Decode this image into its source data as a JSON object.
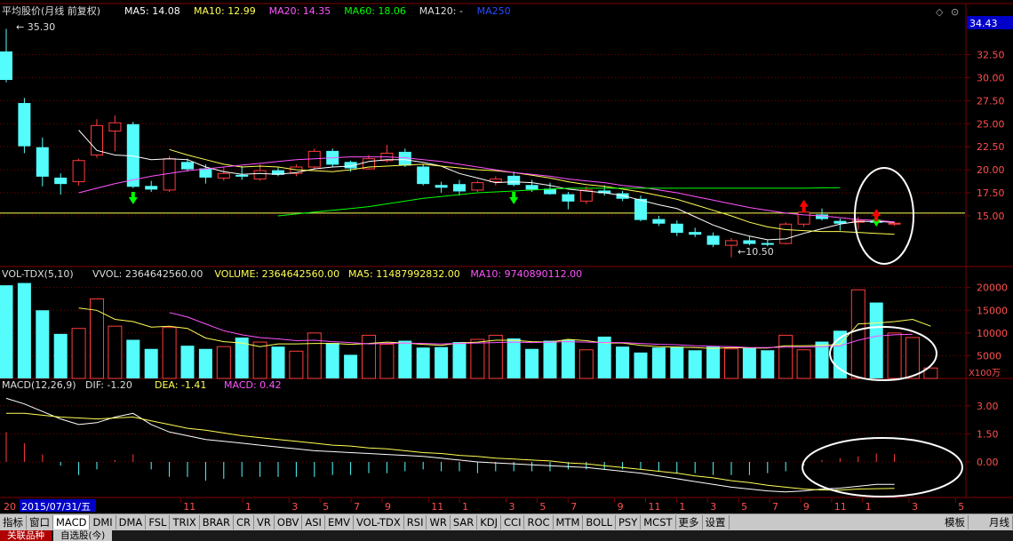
{
  "colors": {
    "up": "#ff3c3c",
    "down": "#54fcfc",
    "ma5": "#ffffff",
    "ma10": "#ffff54",
    "ma20": "#ff54ff",
    "ma60": "#00ff00",
    "ma250": "#2a4bff",
    "grid": "#800000",
    "hline": "#ffff54",
    "circle": "#ffffff"
  },
  "chart_data": [
    {
      "type": "candlestick",
      "title": "平均股价(月线 前复权)",
      "ma_legend": [
        {
          "name": "MA5",
          "text": "MA5: 14.08",
          "color": "#ffffff"
        },
        {
          "name": "MA10",
          "text": "MA10: 12.99",
          "color": "#ffff54"
        },
        {
          "name": "MA20",
          "text": "MA20: 14.35",
          "color": "#ff54ff"
        },
        {
          "name": "MA60",
          "text": "MA60: 18.06",
          "color": "#00ff00"
        },
        {
          "name": "MA120",
          "text": "MA120: -",
          "color": "#dddddd"
        },
        {
          "name": "MA250",
          "text": "MA250",
          "color": "#2a4bff"
        }
      ],
      "ylim": [
        9.5,
        36.5
      ],
      "y_ticks": [
        15.0,
        17.5,
        20.0,
        22.5,
        25.0,
        27.5,
        30.0,
        32.5
      ],
      "y_tick_labels": [
        "15.00",
        "17.50",
        "20.00",
        "22.50",
        "25.00",
        "27.50",
        "30.00",
        "32.50"
      ],
      "current_price_label": "34.43",
      "high_annotation": "35.30",
      "low_annotation": "10.50",
      "horizontal_line": 15.3,
      "candles": [
        {
          "o": 32.8,
          "h": 35.3,
          "l": 29.5,
          "c": 29.8
        },
        {
          "o": 27.2,
          "h": 27.8,
          "l": 21.8,
          "c": 22.6
        },
        {
          "o": 22.4,
          "h": 23.5,
          "l": 18.2,
          "c": 19.3
        },
        {
          "o": 19.1,
          "h": 19.6,
          "l": 17.3,
          "c": 18.5
        },
        {
          "o": 18.7,
          "h": 21.2,
          "l": 18.3,
          "c": 21.0
        },
        {
          "o": 21.6,
          "h": 25.5,
          "l": 21.3,
          "c": 24.8
        },
        {
          "o": 24.2,
          "h": 25.9,
          "l": 22.0,
          "c": 25.1
        },
        {
          "o": 24.9,
          "h": 25.2,
          "l": 18.0,
          "c": 18.2
        },
        {
          "o": 18.2,
          "h": 18.8,
          "l": 17.6,
          "c": 17.9
        },
        {
          "o": 17.8,
          "h": 21.5,
          "l": 17.6,
          "c": 21.2
        },
        {
          "o": 20.8,
          "h": 21.2,
          "l": 19.8,
          "c": 20.1
        },
        {
          "o": 20.1,
          "h": 20.6,
          "l": 18.5,
          "c": 19.2
        },
        {
          "o": 19.1,
          "h": 20.3,
          "l": 18.8,
          "c": 19.6
        },
        {
          "o": 19.4,
          "h": 20.4,
          "l": 18.9,
          "c": 19.3
        },
        {
          "o": 19.0,
          "h": 20.6,
          "l": 18.8,
          "c": 19.9
        },
        {
          "o": 19.9,
          "h": 20.3,
          "l": 19.3,
          "c": 19.5
        },
        {
          "o": 19.6,
          "h": 20.6,
          "l": 19.3,
          "c": 20.3
        },
        {
          "o": 20.3,
          "h": 22.3,
          "l": 20.0,
          "c": 22.0
        },
        {
          "o": 22.0,
          "h": 22.3,
          "l": 20.3,
          "c": 20.6
        },
        {
          "o": 20.8,
          "h": 21.0,
          "l": 19.8,
          "c": 20.2
        },
        {
          "o": 20.1,
          "h": 21.6,
          "l": 20.0,
          "c": 21.2
        },
        {
          "o": 21.0,
          "h": 22.7,
          "l": 20.8,
          "c": 21.8
        },
        {
          "o": 21.9,
          "h": 22.3,
          "l": 20.3,
          "c": 20.5
        },
        {
          "o": 20.3,
          "h": 20.6,
          "l": 18.3,
          "c": 18.5
        },
        {
          "o": 18.3,
          "h": 18.7,
          "l": 17.5,
          "c": 18.1
        },
        {
          "o": 18.4,
          "h": 18.9,
          "l": 17.2,
          "c": 17.7
        },
        {
          "o": 17.8,
          "h": 18.8,
          "l": 17.6,
          "c": 18.6
        },
        {
          "o": 18.7,
          "h": 19.3,
          "l": 18.3,
          "c": 19.0
        },
        {
          "o": 19.3,
          "h": 19.8,
          "l": 18.2,
          "c": 18.4
        },
        {
          "o": 18.3,
          "h": 18.9,
          "l": 17.6,
          "c": 17.9
        },
        {
          "o": 17.9,
          "h": 18.6,
          "l": 17.3,
          "c": 17.4
        },
        {
          "o": 17.3,
          "h": 17.6,
          "l": 15.7,
          "c": 16.6
        },
        {
          "o": 16.6,
          "h": 18.2,
          "l": 16.3,
          "c": 17.8
        },
        {
          "o": 17.7,
          "h": 18.3,
          "l": 17.2,
          "c": 17.5
        },
        {
          "o": 17.4,
          "h": 17.7,
          "l": 16.6,
          "c": 16.9
        },
        {
          "o": 16.8,
          "h": 17.2,
          "l": 14.4,
          "c": 14.6
        },
        {
          "o": 14.6,
          "h": 15.0,
          "l": 13.9,
          "c": 14.2
        },
        {
          "o": 14.1,
          "h": 14.5,
          "l": 12.8,
          "c": 13.2
        },
        {
          "o": 13.2,
          "h": 13.7,
          "l": 12.7,
          "c": 13.0
        },
        {
          "o": 12.8,
          "h": 13.2,
          "l": 11.6,
          "c": 11.9
        },
        {
          "o": 11.8,
          "h": 12.6,
          "l": 10.5,
          "c": 12.3
        },
        {
          "o": 12.3,
          "h": 12.8,
          "l": 11.8,
          "c": 12.0
        },
        {
          "o": 12.0,
          "h": 12.4,
          "l": 11.7,
          "c": 11.9
        },
        {
          "o": 12.0,
          "h": 14.3,
          "l": 11.9,
          "c": 14.1
        },
        {
          "o": 14.1,
          "h": 15.6,
          "l": 13.8,
          "c": 15.4
        },
        {
          "o": 15.1,
          "h": 15.8,
          "l": 14.5,
          "c": 14.7
        },
        {
          "o": 14.4,
          "h": 14.7,
          "l": 13.4,
          "c": 14.2
        },
        {
          "o": 14.3,
          "h": 14.9,
          "l": 13.5,
          "c": 14.5
        },
        {
          "o": 14.4,
          "h": 14.6,
          "l": 14.0,
          "c": 14.3
        },
        {
          "o": 14.1,
          "h": 14.3,
          "l": 13.9,
          "c": 14.2
        }
      ],
      "ma5": [
        null,
        null,
        null,
        null,
        24.3,
        22.1,
        21.6,
        21.5,
        21.1,
        21.2,
        21.1,
        20.3,
        19.8,
        19.5,
        19.6,
        19.5,
        19.7,
        20.1,
        20.3,
        20.4,
        20.9,
        21.1,
        21.1,
        20.8,
        20.4,
        19.6,
        19.1,
        18.6,
        18.7,
        18.6,
        18.3,
        17.9,
        17.7,
        17.5,
        17.2,
        16.7,
        16.2,
        15.8,
        14.9,
        14.0,
        13.3,
        12.8,
        12.4,
        12.5,
        13.1,
        13.6,
        14.1,
        14.4,
        14.4,
        14.3
      ],
      "ma10": [
        null,
        null,
        null,
        null,
        null,
        null,
        null,
        null,
        null,
        22.2,
        21.6,
        21.1,
        20.6,
        20.3,
        20.4,
        20.3,
        20.0,
        19.9,
        19.8,
        20.0,
        20.3,
        20.4,
        20.5,
        20.6,
        20.4,
        20.2,
        20.0,
        19.9,
        19.7,
        19.4,
        19.1,
        18.7,
        18.4,
        18.2,
        17.9,
        17.6,
        17.2,
        16.8,
        16.2,
        15.6,
        15.0,
        14.3,
        13.8,
        13.5,
        13.4,
        13.3,
        13.3,
        13.2,
        13.1,
        13.0
      ],
      "ma20": [
        null,
        null,
        null,
        null,
        17.5,
        18.0,
        18.5,
        18.9,
        19.3,
        19.6,
        19.9,
        20.1,
        20.3,
        20.5,
        20.7,
        20.9,
        21.1,
        21.2,
        21.3,
        21.4,
        21.4,
        21.4,
        21.3,
        21.1,
        20.9,
        20.6,
        20.3,
        20.0,
        19.7,
        19.5,
        19.3,
        19.0,
        18.8,
        18.6,
        18.3,
        18.1,
        17.8,
        17.5,
        17.1,
        16.7,
        16.3,
        15.9,
        15.6,
        15.3,
        15.1,
        15.0,
        14.8,
        14.6,
        14.5,
        14.35
      ],
      "ma60_start": 15,
      "ma60": [
        15.0,
        15.2,
        15.4,
        15.6,
        15.8,
        16.0,
        16.3,
        16.6,
        16.9,
        17.1,
        17.3,
        17.5,
        17.6,
        17.7,
        17.8,
        17.9,
        18.0,
        18.0,
        18.0,
        18.0,
        18.0,
        18.0,
        18.0,
        18.0,
        18.0,
        18.0,
        18.0,
        18.0,
        18.0,
        18.0,
        18.03,
        18.06
      ],
      "arrows": [
        {
          "i": 7,
          "dir": "down",
          "color": "#00ff00"
        },
        {
          "i": 28,
          "dir": "down",
          "color": "#00ff00"
        },
        {
          "i": 44,
          "dir": "up",
          "color": "#ff0000"
        },
        {
          "i": 48,
          "dir": "down",
          "color": "#00ff00"
        },
        {
          "i": 48,
          "dir": "up",
          "color": "#ff0000"
        }
      ]
    },
    {
      "type": "bar",
      "title": "VOL-TDX(5,10)",
      "legend": [
        {
          "text": "VVOL: 2364642560.00",
          "color": "#dddddd"
        },
        {
          "text": "VOLUME: 2364642560.00",
          "color": "#ffff54"
        },
        {
          "text": "MA5: 11487992832.00",
          "color": "#ffff54"
        },
        {
          "text": "MA10: 9740890112.00",
          "color": "#ff54ff"
        }
      ],
      "ylim": [
        0,
        21500
      ],
      "y_ticks": [
        5000,
        10000,
        15000,
        20000
      ],
      "y_tick_labels": [
        "5000",
        "10000",
        "15000",
        "20000"
      ],
      "unit_label": "X100万",
      "values": [
        20500,
        21000,
        15000,
        9800,
        11000,
        17500,
        11500,
        8500,
        6500,
        11200,
        7200,
        6500,
        7000,
        9000,
        8000,
        7000,
        6000,
        10000,
        7800,
        5200,
        9500,
        7500,
        8300,
        6800,
        6900,
        8000,
        8600,
        9500,
        8800,
        6500,
        8300,
        8500,
        6300,
        9200,
        7000,
        5700,
        6800,
        7000,
        6200,
        7000,
        6500,
        6800,
        6200,
        9500,
        6300,
        8100,
        10500,
        19500,
        16700,
        10000,
        9000,
        2300
      ],
      "ma5": [
        null,
        null,
        null,
        null,
        15500,
        15000,
        13000,
        12500,
        11300,
        11500,
        11000,
        8900,
        8100,
        7800,
        7000,
        7600,
        7600,
        7700,
        7700,
        7500,
        7700,
        8000,
        7800,
        7500,
        7300,
        7800,
        8000,
        8400,
        8400,
        8100,
        8000,
        8600,
        8300,
        7800,
        7800,
        7300,
        7000,
        6900,
        6800,
        6600,
        6800,
        6700,
        6700,
        7200,
        7200,
        7300,
        7500,
        12000,
        12200,
        12500,
        13000,
        11487
      ],
      "ma10": [
        null,
        null,
        null,
        null,
        null,
        null,
        null,
        null,
        null,
        14500,
        13500,
        12000,
        10500,
        9600,
        9000,
        8700,
        8300,
        8400,
        8100,
        7900,
        7600,
        7700,
        7800,
        7700,
        7600,
        7700,
        7800,
        7900,
        8000,
        7900,
        8000,
        8100,
        8000,
        7900,
        7900,
        7700,
        7500,
        7400,
        7200,
        7100,
        7000,
        6800,
        6800,
        6900,
        6900,
        7000,
        7200,
        8400,
        9300,
        9600,
        9740
      ]
    },
    {
      "type": "macd",
      "title": "MACD(12,26,9)",
      "legend": [
        {
          "text": "DIF: -1.20",
          "color": "#dddddd"
        },
        {
          "text": "DEA: -1.41",
          "color": "#ffff54"
        },
        {
          "text": "MACD: 0.42",
          "color": "#ff54ff"
        }
      ],
      "ylim": [
        -1.9,
        3.8
      ],
      "y_ticks": [
        0,
        1.5,
        3.0
      ],
      "y_tick_labels": [
        "0.00",
        "1.50",
        "3.00"
      ],
      "dif": [
        3.4,
        3.1,
        2.7,
        2.3,
        2.0,
        2.1,
        2.4,
        2.6,
        2.0,
        1.6,
        1.4,
        1.2,
        1.1,
        1.0,
        0.9,
        0.8,
        0.7,
        0.6,
        0.55,
        0.5,
        0.45,
        0.4,
        0.35,
        0.3,
        0.2,
        0.1,
        0.0,
        -0.05,
        -0.1,
        -0.15,
        -0.2,
        -0.25,
        -0.3,
        -0.4,
        -0.5,
        -0.6,
        -0.75,
        -0.9,
        -1.05,
        -1.2,
        -1.35,
        -1.45,
        -1.55,
        -1.6,
        -1.55,
        -1.45,
        -1.4,
        -1.3,
        -1.2,
        -1.2
      ],
      "dea": [
        2.6,
        2.6,
        2.5,
        2.4,
        2.35,
        2.3,
        2.35,
        2.4,
        2.2,
        2.0,
        1.8,
        1.7,
        1.55,
        1.4,
        1.3,
        1.2,
        1.1,
        1.0,
        0.9,
        0.85,
        0.75,
        0.7,
        0.6,
        0.5,
        0.45,
        0.35,
        0.3,
        0.2,
        0.15,
        0.1,
        0.05,
        -0.05,
        -0.1,
        -0.2,
        -0.3,
        -0.4,
        -0.5,
        -0.6,
        -0.75,
        -0.85,
        -1.0,
        -1.1,
        -1.25,
        -1.35,
        -1.45,
        -1.5,
        -1.5,
        -1.45,
        -1.43,
        -1.41
      ],
      "macd": [
        1.6,
        1.0,
        0.4,
        -0.2,
        -0.7,
        -0.4,
        0.1,
        0.4,
        -0.4,
        -0.8,
        -0.8,
        -1.0,
        -0.9,
        -0.8,
        -0.8,
        -0.8,
        -0.8,
        -0.8,
        -0.7,
        -0.7,
        -0.6,
        -0.6,
        -0.5,
        -0.4,
        -0.5,
        -0.5,
        -0.6,
        -0.5,
        -0.5,
        -0.5,
        -0.5,
        -0.4,
        -0.4,
        -0.4,
        -0.4,
        -0.4,
        -0.5,
        -0.6,
        -0.6,
        -0.7,
        -0.7,
        -0.7,
        -0.6,
        -0.5,
        -0.2,
        0.1,
        0.2,
        0.3,
        0.45,
        0.42
      ]
    }
  ],
  "x_axis": {
    "date_label": "2015/07/31/五",
    "left_label": "20",
    "ticks": [
      {
        "i": 5,
        "t": "11"
      },
      {
        "i": 9,
        "t": "1"
      },
      {
        "i": 12,
        "t": "3"
      },
      {
        "i": 14,
        "t": "5"
      },
      {
        "i": 16,
        "t": "7"
      },
      {
        "i": 18,
        "t": "9"
      },
      {
        "i": 21,
        "t": "11"
      },
      {
        "i": 23,
        "t": "1"
      },
      {
        "i": 26,
        "t": "3"
      },
      {
        "i": 28,
        "t": "5"
      },
      {
        "i": 30,
        "t": "7"
      },
      {
        "i": 33,
        "t": "9"
      },
      {
        "i": 35,
        "t": "11"
      },
      {
        "i": 37,
        "t": "1"
      },
      {
        "i": 39,
        "t": "3"
      },
      {
        "i": 41,
        "t": "5"
      },
      {
        "i": 43,
        "t": "7"
      },
      {
        "i": 45,
        "t": "9"
      },
      {
        "i": 47,
        "t": "11"
      },
      {
        "i": 49,
        "t": "1"
      },
      {
        "i": 52,
        "t": "3"
      },
      {
        "i": 55,
        "t": "5"
      },
      {
        "i": 58,
        "t": "7"
      }
    ]
  },
  "toolbar": {
    "items": [
      "指标",
      "窗口",
      "MACD",
      "DMI",
      "DMA",
      "FSL",
      "TRIX",
      "BRAR",
      "CR",
      "VR",
      "OBV",
      "ASI",
      "EMV",
      "VOL-TDX",
      "RSI",
      "WR",
      "SAR",
      "KDJ",
      "CCI",
      "ROC",
      "MTM",
      "BOLL",
      "PSY",
      "MCST",
      "更多",
      "设置"
    ],
    "active": "MACD",
    "template": "模板",
    "period": "月线"
  },
  "tabs": [
    "关联品种",
    "自选股(今)"
  ],
  "window_icons": [
    "◇",
    "⊙"
  ]
}
